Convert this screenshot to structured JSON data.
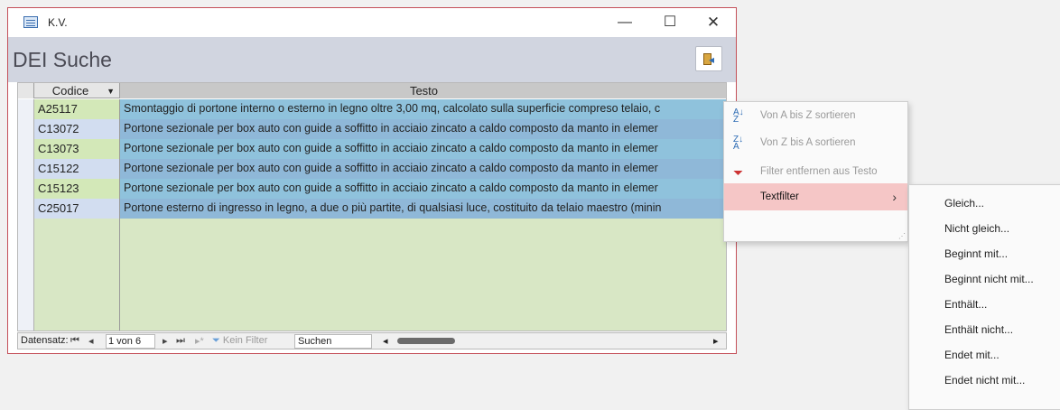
{
  "window": {
    "title": "K.V.",
    "minimize": "—",
    "maximize": "☐",
    "close": "✕"
  },
  "form": {
    "title": "DEI Suche",
    "exit_icon": "exit-door-icon"
  },
  "grid": {
    "columns": [
      "Codice",
      "Testo"
    ],
    "rows": [
      {
        "code": "A25117",
        "text": "Smontaggio di portone interno o esterno in legno oltre 3,00 mq, calcolato sulla superficie compreso telaio, c"
      },
      {
        "code": "C13072",
        "text": "Portone sezionale per box auto con guide a soffitto in acciaio zincato a caldo composto da manto in elemer"
      },
      {
        "code": "C13073",
        "text": "Portone sezionale per box auto con guide a soffitto in acciaio zincato a caldo composto da manto in elemer"
      },
      {
        "code": "C15122",
        "text": "Portone sezionale per box auto con guide a soffitto in acciaio zincato a caldo composto da manto in elemer"
      },
      {
        "code": "C15123",
        "text": "Portone sezionale per box auto con guide a soffitto in acciaio zincato a caldo composto da manto in elemer"
      },
      {
        "code": "C25017",
        "text": "Portone esterno di ingresso in legno, a due o più partite, di qualsiasi luce, costituito da telaio maestro (minin"
      }
    ]
  },
  "nav": {
    "label": "Datensatz:",
    "first": "⏮",
    "prev": "◂",
    "position": "1 von 6",
    "next": "▸",
    "last": "⏭",
    "new": "▸*",
    "filter": "Kein Filter",
    "search": "Suchen",
    "left": "◂",
    "right": "▸"
  },
  "context_menu": {
    "sort_az": "Von A bis Z sortieren",
    "sort_za": "Von Z bis A sortieren",
    "remove_filter": "Filter entfernen aus Testo",
    "textfilter": "Textfilter",
    "chevron": "›"
  },
  "submenu": [
    "Gleich...",
    "Nicht gleich...",
    "Beginnt mit...",
    "Beginnt nicht mit...",
    "Enthält...",
    "Enthält nicht...",
    "Endet mit...",
    "Endet nicht mit..."
  ]
}
